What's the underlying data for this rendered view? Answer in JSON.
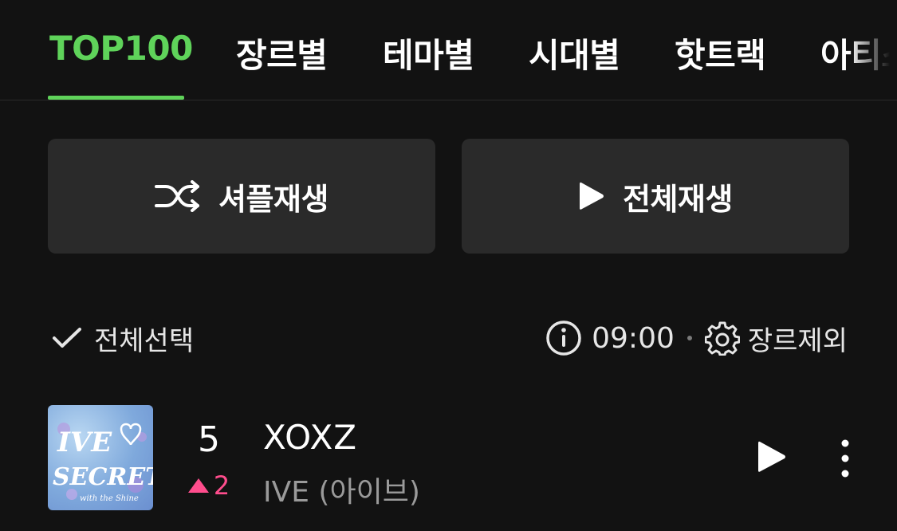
{
  "tabs": [
    {
      "label": "TOP100",
      "active": true
    },
    {
      "label": "장르별"
    },
    {
      "label": "테마별"
    },
    {
      "label": "시대별"
    },
    {
      "label": "핫트랙"
    },
    {
      "label": "아티스"
    }
  ],
  "actions": {
    "shuffle_label": "셔플재생",
    "play_all_label": "전체재생"
  },
  "toolbar": {
    "select_all_label": "전체선택",
    "time": "09:00",
    "genre_exclude_label": "장르제외"
  },
  "songs": [
    {
      "rank": "5",
      "change": "2",
      "change_direction": "up",
      "title": "XOXZ",
      "artist": "IVE (아이브)",
      "album_art_text": "IVE SECRET"
    }
  ],
  "colors": {
    "accent": "#5fd35a",
    "rank_up": "#ff4d8d",
    "background": "#121212",
    "button_bg": "#2a2a2a"
  },
  "icons": [
    "shuffle-icon",
    "play-icon",
    "check-icon",
    "info-icon",
    "gear-icon",
    "more-vertical-icon"
  ]
}
